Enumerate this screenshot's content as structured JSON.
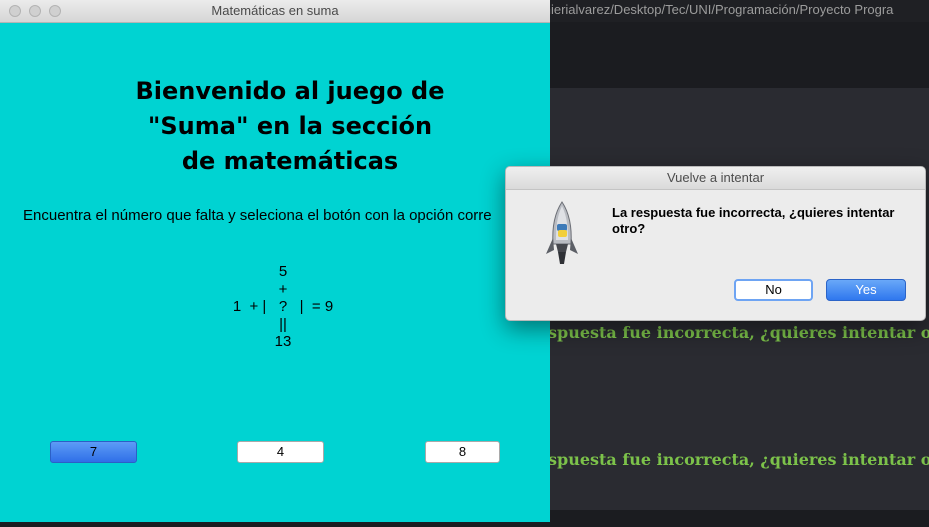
{
  "background_window": {
    "path": "almierialvarez/Desktop/Tec/UNI/Programación/Proyecto Progra",
    "lines": [
      "spuesta fue incorrecta, ¿quieres intentar o",
      "spuesta fue incorrecta, ¿quieres intentar o"
    ]
  },
  "game": {
    "window_title": "Matemáticas en suma",
    "welcome_lines": [
      "Bienvenido al juego de",
      "\"Suma\" en la sección",
      "de matemáticas"
    ],
    "instructions": "Encuentra el número que falta y seleciona el botón con la opción corre",
    "puzzle": {
      "top": "5",
      "plus": "+",
      "row": "1  + |   ?   |  = 9",
      "equals": "||",
      "bottom": "13"
    },
    "options": [
      {
        "label": "7",
        "selected": true
      },
      {
        "label": "4",
        "selected": false
      },
      {
        "label": "8",
        "selected": false
      }
    ]
  },
  "dialog": {
    "title": "Vuelve a intentar",
    "message": "La respuesta fue incorrecta, ¿quieres intentar otro?",
    "icon": "python-rocket-icon",
    "no_label": "No",
    "yes_label": "Yes"
  },
  "colors": {
    "game_background": "#00d3d2",
    "accent_blue": "#2f77ee",
    "terminal_text": "#7cc24a"
  }
}
